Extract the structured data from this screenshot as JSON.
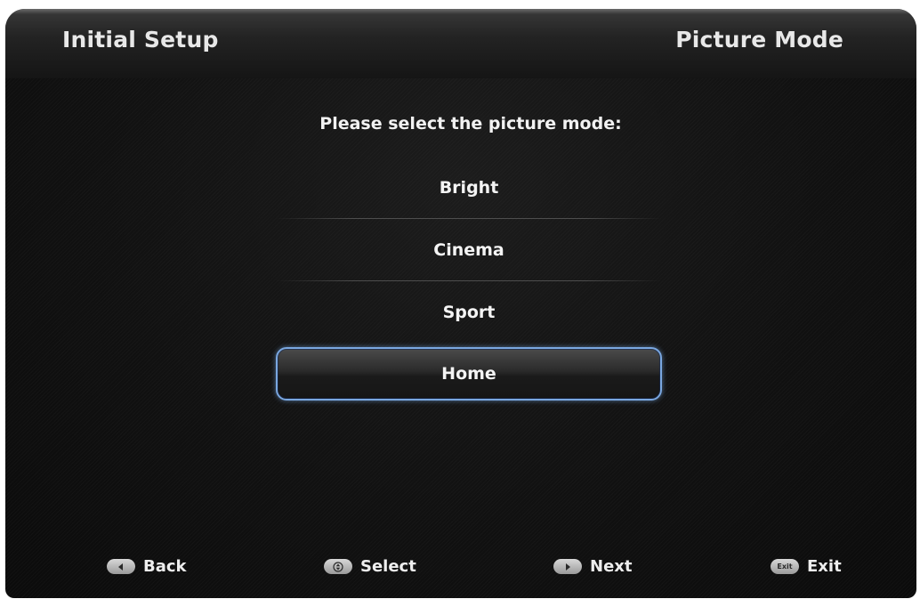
{
  "header": {
    "title": "Initial Setup",
    "page": "Picture Mode"
  },
  "prompt": "Please select the picture mode:",
  "options": [
    {
      "label": "Bright",
      "selected": false
    },
    {
      "label": "Cinema",
      "selected": false
    },
    {
      "label": "Sport",
      "selected": false
    },
    {
      "label": "Home",
      "selected": true
    }
  ],
  "footer": {
    "back": {
      "icon": "left-arrow-icon",
      "label": "Back"
    },
    "select": {
      "icon": "up-down-icon",
      "label": "Select"
    },
    "next": {
      "icon": "right-arrow-icon",
      "label": "Next"
    },
    "exit": {
      "icon": "exit-key-icon",
      "icon_text": "Exit",
      "label": "Exit"
    }
  },
  "colors": {
    "background": "#111111",
    "highlight_border": "#7aa7e0",
    "text": "#f0f0f0"
  }
}
